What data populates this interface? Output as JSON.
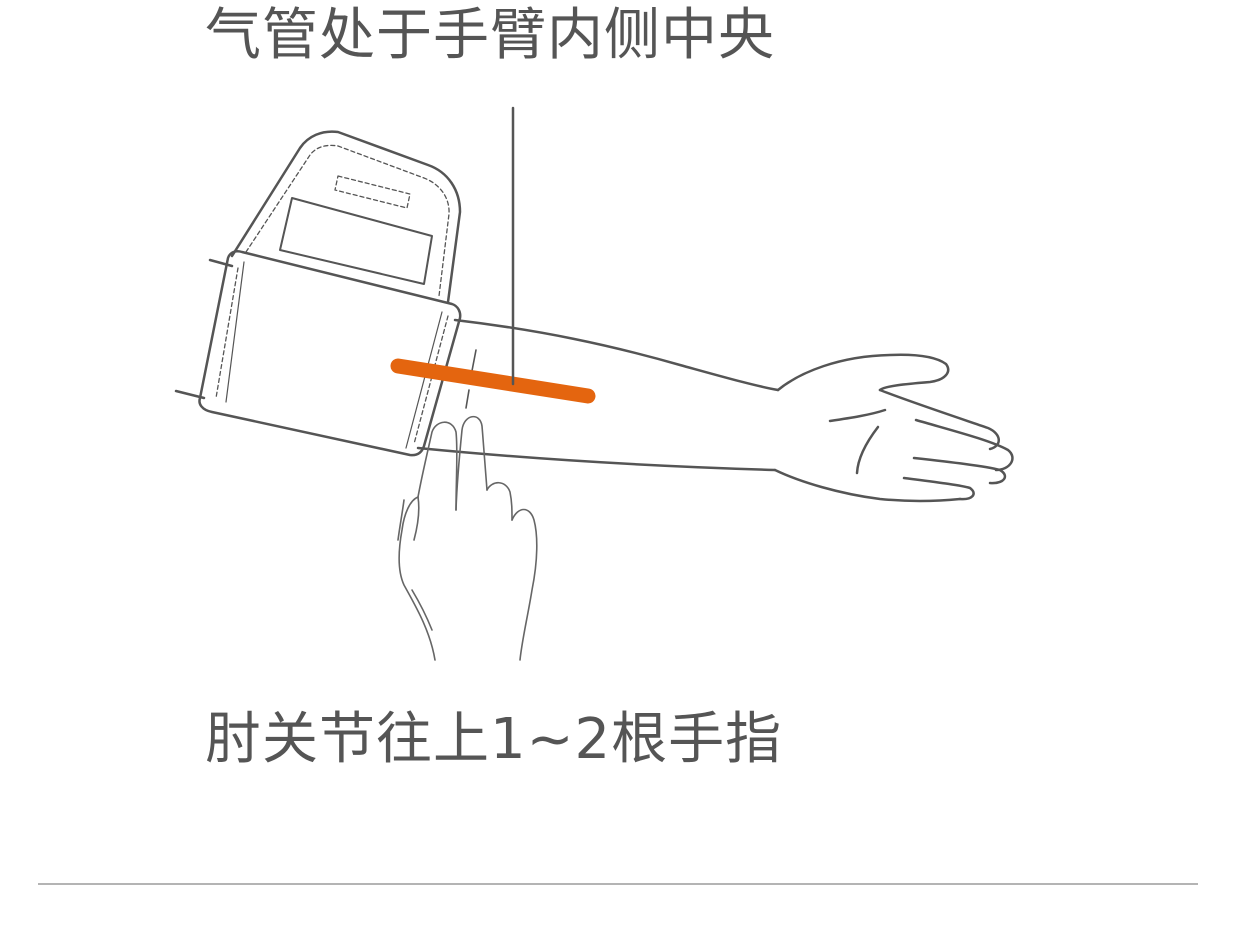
{
  "captions": {
    "top": "气管处于手臂内侧中央",
    "bottom": "肘关节往上1~2根手指"
  },
  "colors": {
    "line": "#555555",
    "tube": "#e4650f",
    "divider": "#b4b4b4",
    "background": "#ffffff"
  },
  "icons": {
    "cuff": "blood-pressure-cuff-icon",
    "arm": "arm-icon",
    "hand": "two-finger-hand-icon"
  }
}
